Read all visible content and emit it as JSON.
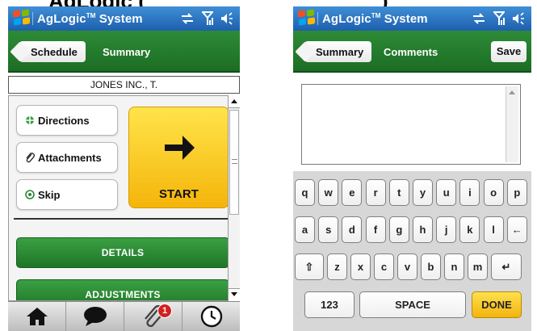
{
  "caption": {
    "text": "AgLogic (",
    "right_text": ")"
  },
  "statusbar": {
    "title_main": "AgLogic",
    "title_tm": "TM",
    "title_rest": " System"
  },
  "left_screen": {
    "nav": {
      "back_label": "Schedule",
      "current_label": "Summary"
    },
    "customer_name": "JONES INC., T.",
    "actions": [
      {
        "label": "Directions"
      },
      {
        "label": "Attachments"
      },
      {
        "label": "Skip"
      }
    ],
    "start_label": "START",
    "details_label": "DETAILS",
    "adjustments_label": "ADJUSTMENTS",
    "tabbar": {
      "attachments_badge": "1"
    }
  },
  "right_screen": {
    "nav": {
      "back_label": "Summary",
      "current_label": "Comments",
      "save_label": "Save"
    },
    "keyboard": {
      "row1": [
        "q",
        "w",
        "e",
        "r",
        "t",
        "y",
        "u",
        "i",
        "o",
        "p"
      ],
      "row2": [
        "a",
        "s",
        "d",
        "f",
        "g",
        "h",
        "j",
        "k",
        "l",
        "←"
      ],
      "row3": [
        "⇧",
        "z",
        "x",
        "c",
        "v",
        "b",
        "n",
        "m",
        "↵"
      ],
      "numbers_label": "123",
      "space_label": "SPACE",
      "done_label": "DONE"
    }
  },
  "colors": {
    "status_blue": "#1e5fae",
    "header_green": "#1c6d24",
    "start_yellow": "#f5b50a",
    "badge_red": "#d32020"
  }
}
